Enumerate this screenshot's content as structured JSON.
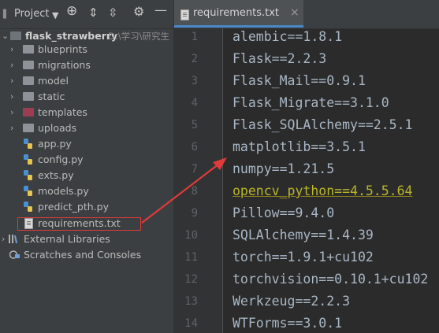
{
  "toolbar": {
    "project_label": "Project",
    "dropdown_icon": "chevron-down-icon",
    "icons": [
      "locate-icon",
      "expand-all-icon",
      "collapse-all-icon",
      "settings-icon",
      "hide-icon"
    ]
  },
  "tree": {
    "root": {
      "name": "flask_strawberry",
      "path": "D:\\学习\\研究生"
    },
    "items": [
      {
        "label": "blueprints",
        "kind": "folder"
      },
      {
        "label": "migrations",
        "kind": "folder"
      },
      {
        "label": "model",
        "kind": "folder"
      },
      {
        "label": "static",
        "kind": "folder"
      },
      {
        "label": "templates",
        "kind": "folder-templates"
      },
      {
        "label": "uploads",
        "kind": "folder"
      },
      {
        "label": "app.py",
        "kind": "py"
      },
      {
        "label": "config.py",
        "kind": "py"
      },
      {
        "label": "exts.py",
        "kind": "py"
      },
      {
        "label": "models.py",
        "kind": "py"
      },
      {
        "label": "predict_pth.py",
        "kind": "py"
      },
      {
        "label": "requirements.txt",
        "kind": "txt"
      }
    ],
    "external_libraries": "External Libraries",
    "scratches": "Scratches and Consoles"
  },
  "editor": {
    "tab_label": "requirements.txt",
    "lines": [
      {
        "n": "1",
        "text": "alembic==1.8.1"
      },
      {
        "n": "2",
        "text": "Flask==2.2.3"
      },
      {
        "n": "3",
        "text": "Flask_Mail==0.9.1"
      },
      {
        "n": "4",
        "text": "Flask_Migrate==3.1.0"
      },
      {
        "n": "5",
        "text": "Flask_SQLAlchemy==2.5.1"
      },
      {
        "n": "6",
        "text": "matplotlib==3.5.1"
      },
      {
        "n": "7",
        "text": "numpy==1.21.5"
      },
      {
        "n": "8",
        "text": "opencv_python==4.5.5.64"
      },
      {
        "n": "9",
        "text": "Pillow==9.4.0"
      },
      {
        "n": "10",
        "text": "SQLAlchemy==1.4.39"
      },
      {
        "n": "11",
        "text": "torch==1.9.1+cu102"
      },
      {
        "n": "12",
        "text": "torchvision==0.10.1+cu102"
      },
      {
        "n": "13",
        "text": "Werkzeug==2.2.3"
      },
      {
        "n": "14",
        "text": "WTForms==3.0.1"
      }
    ]
  },
  "colors": {
    "annotation": "#e03a3a",
    "warning_text": "#bbb529",
    "code_text": "#a9b7c6",
    "templates_folder": "#9b3e52"
  }
}
